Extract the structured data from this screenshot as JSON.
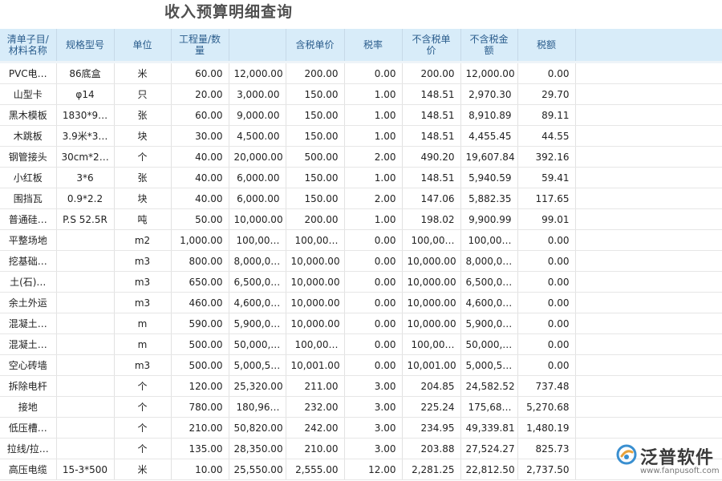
{
  "page": {
    "title": "收入预算明细查询"
  },
  "table": {
    "columns": [
      "清单子目/\n材料名称",
      "规格型号",
      "单位",
      "工程量/数\n量",
      "",
      "含税单价",
      "税率",
      "不含税单\n价",
      "不含税金\n额",
      "税额",
      ""
    ],
    "rows": [
      [
        "PVC电…",
        "86底盒",
        "米",
        "60.00",
        "12,000.00",
        "200.00",
        "0.00",
        "200.00",
        "12,000.00",
        "0.00"
      ],
      [
        "山型卡",
        "φ14",
        "只",
        "20.00",
        "3,000.00",
        "150.00",
        "1.00",
        "148.51",
        "2,970.30",
        "29.70"
      ],
      [
        "黑木模板",
        "1830*9…",
        "张",
        "60.00",
        "9,000.00",
        "150.00",
        "1.00",
        "148.51",
        "8,910.89",
        "89.11"
      ],
      [
        "木跳板",
        "3.9米*3…",
        "块",
        "30.00",
        "4,500.00",
        "150.00",
        "1.00",
        "148.51",
        "4,455.45",
        "44.55"
      ],
      [
        "钢管接头",
        "30cm*2…",
        "个",
        "40.00",
        "20,000.00",
        "500.00",
        "2.00",
        "490.20",
        "19,607.84",
        "392.16"
      ],
      [
        "小红板",
        "3*6",
        "张",
        "40.00",
        "6,000.00",
        "150.00",
        "1.00",
        "148.51",
        "5,940.59",
        "59.41"
      ],
      [
        "围挡瓦",
        "0.9*2.2",
        "块",
        "40.00",
        "6,000.00",
        "150.00",
        "2.00",
        "147.06",
        "5,882.35",
        "117.65"
      ],
      [
        "普通硅…",
        "P.S 52.5R",
        "吨",
        "50.00",
        "10,000.00",
        "200.00",
        "1.00",
        "198.02",
        "9,900.99",
        "99.01"
      ],
      [
        "平整场地",
        "",
        "m2",
        "1,000.00",
        "100,00…",
        "100,00…",
        "0.00",
        "100,00…",
        "100,00…",
        "0.00"
      ],
      [
        "挖基础…",
        "",
        "m3",
        "800.00",
        "8,000,0…",
        "10,000.00",
        "0.00",
        "10,000.00",
        "8,000,0…",
        "0.00"
      ],
      [
        "土(石)…",
        "",
        "m3",
        "650.00",
        "6,500,0…",
        "10,000.00",
        "0.00",
        "10,000.00",
        "6,500,0…",
        "0.00"
      ],
      [
        "余土外运",
        "",
        "m3",
        "460.00",
        "4,600,0…",
        "10,000.00",
        "0.00",
        "10,000.00",
        "4,600,0…",
        "0.00"
      ],
      [
        "混凝土…",
        "",
        "m",
        "590.00",
        "5,900,0…",
        "10,000.00",
        "0.00",
        "10,000.00",
        "5,900,0…",
        "0.00"
      ],
      [
        "混凝土…",
        "",
        "m",
        "500.00",
        "50,000,…",
        "100,00…",
        "0.00",
        "100,00…",
        "50,000,…",
        "0.00"
      ],
      [
        "空心砖墙",
        "",
        "m3",
        "500.00",
        "5,000,5…",
        "10,001.00",
        "0.00",
        "10,001.00",
        "5,000,5…",
        "0.00"
      ],
      [
        "拆除电杆",
        "",
        "个",
        "120.00",
        "25,320.00",
        "211.00",
        "3.00",
        "204.85",
        "24,582.52",
        "737.48"
      ],
      [
        "接地",
        "",
        "个",
        "780.00",
        "180,96…",
        "232.00",
        "3.00",
        "225.24",
        "175,68…",
        "5,270.68"
      ],
      [
        "低压槽…",
        "",
        "个",
        "210.00",
        "50,820.00",
        "242.00",
        "3.00",
        "234.95",
        "49,339.81",
        "1,480.19"
      ],
      [
        "拉线/拉…",
        "",
        "个",
        "135.00",
        "28,350.00",
        "210.00",
        "3.00",
        "203.88",
        "27,524.27",
        "825.73"
      ],
      [
        "高压电缆",
        "15-3*500",
        "米",
        "10.00",
        "25,550.00",
        "2,555.00",
        "12.00",
        "2,281.25",
        "22,812.50",
        "2,737.50"
      ]
    ]
  },
  "watermark": {
    "brand": "泛普软件",
    "url": "www.fanpusoft.com"
  },
  "colors": {
    "header_bg": "#d8ecf9",
    "header_text": "#2a5c8c",
    "logo_accent": "#3a8fd0"
  }
}
